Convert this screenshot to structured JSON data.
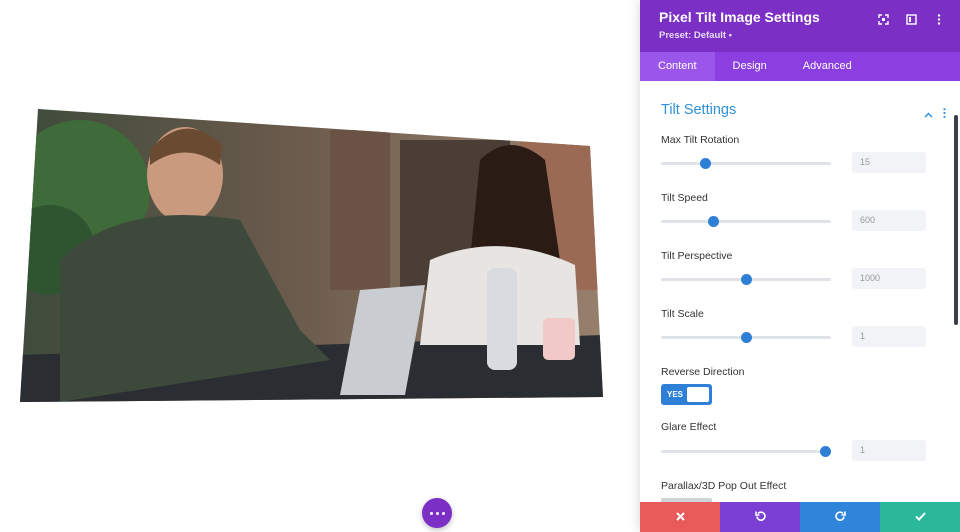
{
  "panel": {
    "title": "Pixel Tilt Image Settings",
    "preset": "Preset: Default •",
    "icons": [
      "expand-icon",
      "sidebar-toggle-icon",
      "more-vertical-icon"
    ]
  },
  "tabs": [
    {
      "label": "Content",
      "active": true
    },
    {
      "label": "Design",
      "active": false
    },
    {
      "label": "Advanced",
      "active": false
    }
  ],
  "section": {
    "title": "Tilt Settings"
  },
  "fields": {
    "max_tilt": {
      "label": "Max Tilt Rotation",
      "value": "15",
      "fraction": 0.26
    },
    "speed": {
      "label": "Tilt Speed",
      "value": "600",
      "fraction": 0.31
    },
    "perspective": {
      "label": "Tilt Perspective",
      "value": "1000",
      "fraction": 0.5
    },
    "scale": {
      "label": "Tilt Scale",
      "value": "1",
      "fraction": 0.5
    },
    "reverse": {
      "label": "Reverse Direction",
      "toggle": "YES"
    },
    "glare": {
      "label": "Glare Effect",
      "value": "1",
      "fraction": 0.97
    },
    "parallax": {
      "label": "Parallax/3D Pop Out Effect"
    }
  },
  "footer": {
    "buttons": [
      {
        "name": "discard",
        "color": "#e95a5a"
      },
      {
        "name": "undo",
        "color": "#7b3fd4"
      },
      {
        "name": "redo",
        "color": "#2e85d9"
      },
      {
        "name": "save",
        "color": "#2ab79a"
      }
    ]
  },
  "colors": {
    "accent": "#7b2fc4",
    "tabbar": "#8c3fe0",
    "link": "#2e91d9",
    "slider": "#2e7fd6"
  }
}
